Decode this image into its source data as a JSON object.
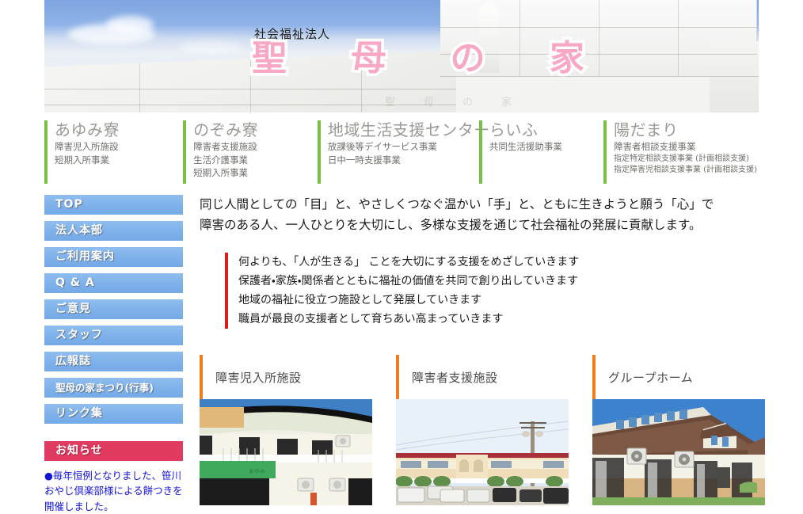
{
  "hero": {
    "subtitle": "社会福祉法人",
    "title_chars": [
      "聖",
      "母",
      "の",
      "家"
    ],
    "watermark_chars": [
      "聖",
      "母",
      "の",
      "家"
    ]
  },
  "facilities": [
    {
      "name": "あゆみ寮",
      "services": [
        "障害児入所施設",
        "短期入所事業"
      ],
      "accent": "#7ac143"
    },
    {
      "name": "のぞみ寮",
      "services": [
        "障害者支援施設",
        "生活介護事業",
        "短期入所事業"
      ],
      "accent": "#7ac143"
    },
    {
      "name": "地域生活支援センター",
      "services": [
        "放課後等デイサービス事業",
        "日中一時支援事業"
      ],
      "accent": "#7ac143"
    },
    {
      "name": "らいふ",
      "services": [
        "共同生活援助事業"
      ],
      "accent": "#7ac143"
    },
    {
      "name": "陽だまり",
      "services": [
        "障害者相談支援事業",
        "指定特定相談支援事業 (計画相談支援)",
        "指定障害児相談支援事業 (計画相談支援)"
      ],
      "accent": "#7ac143"
    }
  ],
  "sidebar": {
    "items": [
      {
        "label": "TOP"
      },
      {
        "label": "法人本部"
      },
      {
        "label": "ご利用案内"
      },
      {
        "label": "Q & A"
      },
      {
        "label": "ご意見"
      },
      {
        "label": "スタッフ"
      },
      {
        "label": "広報誌"
      },
      {
        "label": "聖母の家まつり(行事)"
      },
      {
        "label": "リンク集"
      }
    ],
    "news": {
      "heading": "お知らせ",
      "text": "●毎年恒例となりました、笹川おやじ倶楽部様による餅つきを開催しました。",
      "heading_color": "#e03a60",
      "text_color": "#1414d8"
    },
    "button_color": "#7fb2ea"
  },
  "main": {
    "mission_line1": "同じ人間としての「目」と、やさしくつなぐ温かい「手」と、ともに生きようと願う「心」で",
    "mission_line2": "障害のある人、一人ひとりを大切にし、多様な支援を通じて社会福祉の発展に貢献します。",
    "principles": [
      "何よりも、「人が生きる」 ことを大切にする支援をめざしていきます",
      "保護者・家族・関係者とともに福祉の価値を共同で創り出していきます",
      "地域の福祉に役立つ施設として発展していきます",
      "職員が最良の支援者として育ちあい高まっていきます"
    ],
    "principles_accent": "#e01b1b"
  },
  "cards": [
    {
      "title": "障害児入所施設",
      "photo": "ayumi-building-photo",
      "accent": "#f07d1e"
    },
    {
      "title": "障害者支援施設",
      "photo": "nozomi-building-photo",
      "accent": "#f07d1e"
    },
    {
      "title": "グループホーム",
      "photo": "group-home-photo",
      "accent": "#f07d1e"
    }
  ]
}
